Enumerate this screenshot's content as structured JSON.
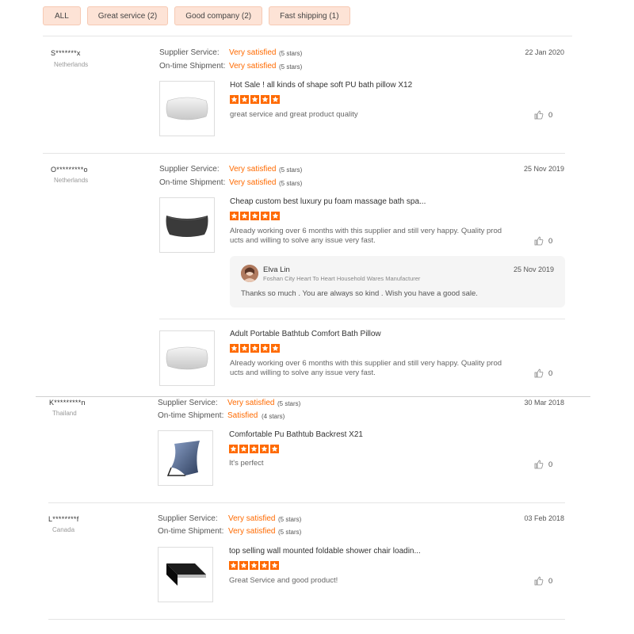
{
  "filters": [
    "ALL",
    "Great service (2)",
    "Good company (2)",
    "Fast shipping (1)"
  ],
  "labels": {
    "supplier_service": "Supplier Service:",
    "ontime_shipment": "On-time Shipment:"
  },
  "reviews": [
    {
      "buyer": "S*******x",
      "country": "Netherlands",
      "date": "22 Jan 2020",
      "supplier_rating": "Very satisfied",
      "supplier_stars": "(5 stars)",
      "shipment_rating": "Very satisfied",
      "shipment_stars": "(5 stars)",
      "product": "Hot Sale ! all kinds of shape soft PU bath pillow X12",
      "comment": "great service and great product quality",
      "likes": "0"
    },
    {
      "buyer": "O*********o",
      "country": "Netherlands",
      "date": "25 Nov 2019",
      "supplier_rating": "Very satisfied",
      "supplier_stars": "(5 stars)",
      "shipment_rating": "Very satisfied",
      "shipment_stars": "(5 stars)",
      "product": "Cheap custom best luxury pu foam massage bath spa...",
      "comment_line1": "Already working over 6 months with this supplier and still very happy. Quality prod",
      "comment_line2": "ucts and willing to solve any issue very fast.",
      "likes": "0",
      "reply": {
        "name": "Elva Lin",
        "company": "Foshan City Heart To Heart Household Wares Manufacturer",
        "date": "25 Nov 2019",
        "text": "Thanks so much . You are always so kind . Wish you have a good sale."
      },
      "extra_product": {
        "product": "Adult Portable Bathtub Comfort Bath Pillow",
        "comment_line1": "Already working over 6 months with this supplier and still very happy. Quality prod",
        "comment_line2": "ucts and willing to solve any issue very fast.",
        "likes": "0"
      }
    },
    {
      "buyer": "K*********n",
      "country": "Thailand",
      "date": "30 Mar 2018",
      "supplier_rating": "Very satisfied",
      "supplier_stars": "(5 stars)",
      "shipment_rating": "Satisfied",
      "shipment_stars": "(4 stars)",
      "product": "Comfortable Pu Bathtub Backrest X21",
      "comment": "It's perfect",
      "likes": "0"
    },
    {
      "buyer": "L********f",
      "country": "Canada",
      "date": "03 Feb 2018",
      "supplier_rating": "Very satisfied",
      "supplier_stars": "(5 stars)",
      "shipment_rating": "Very satisfied",
      "shipment_stars": "(5 stars)",
      "product": "top selling wall mounted foldable shower chair loadin...",
      "comment": "Great Service and good product!",
      "likes": "0"
    }
  ],
  "colors": {
    "accent": "#ff6a00",
    "chip_bg": "#fde3d6"
  }
}
